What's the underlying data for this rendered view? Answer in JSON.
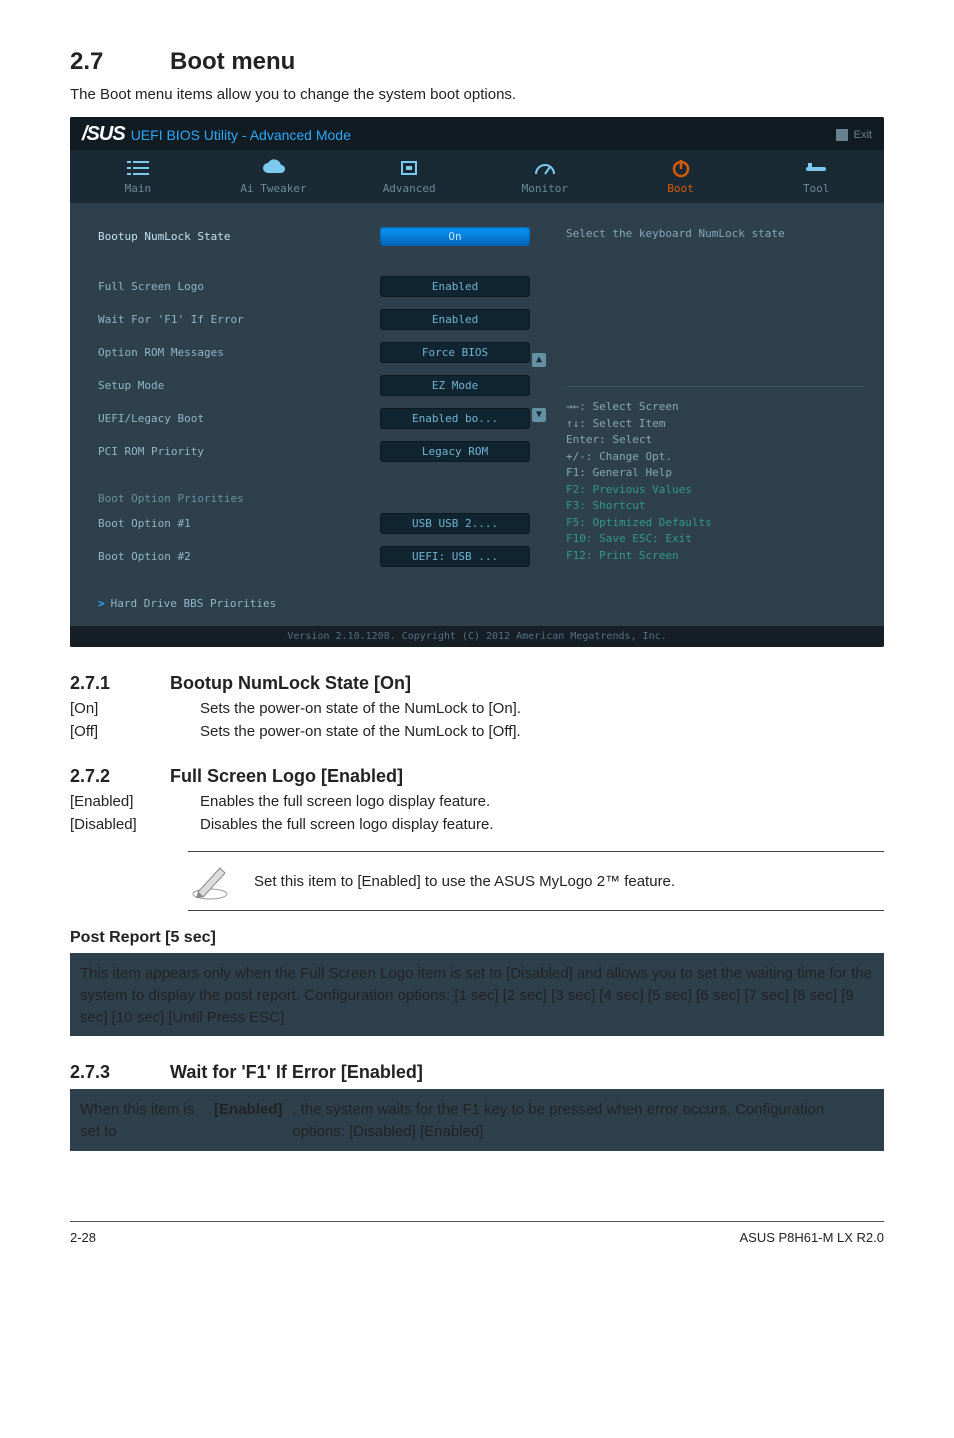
{
  "heading": {
    "num": "2.7",
    "title": "Boot menu"
  },
  "lead": "The Boot menu items allow you to change the system boot options.",
  "bios": {
    "brand": "/SUS",
    "title": "UEFI BIOS Utility - Advanced Mode",
    "exit": "Exit",
    "tabs": [
      {
        "label": "Main"
      },
      {
        "label": "Ai Tweaker"
      },
      {
        "label": "Advanced"
      },
      {
        "label": "Monitor"
      },
      {
        "label": "Boot"
      },
      {
        "label": "Tool"
      }
    ],
    "rows": [
      {
        "label": "Bootup NumLock State",
        "value": "On",
        "hl": true
      },
      {
        "label": "Full Screen Logo",
        "value": "Enabled"
      },
      {
        "label": "Wait For 'F1' If Error",
        "value": "Enabled"
      },
      {
        "label": "Option ROM Messages",
        "value": "Force BIOS"
      },
      {
        "label": "Setup Mode",
        "value": "EZ Mode"
      },
      {
        "label": "UEFI/Legacy Boot",
        "value": "Enabled bo..."
      },
      {
        "label": "PCI ROM Priority",
        "value": "Legacy ROM"
      }
    ],
    "prio_title": "Boot Option Priorities",
    "prio": [
      {
        "label": "Boot Option #1",
        "value": "USB USB 2...."
      },
      {
        "label": "Boot Option #2",
        "value": "UEFI: USB ..."
      }
    ],
    "sublink": "Hard Drive BBS Priorities",
    "help": "Select the keyboard NumLock state",
    "hints": [
      "→←: Select Screen",
      "↑↓: Select Item",
      "Enter: Select",
      "+/-: Change Opt.",
      "F1: General Help",
      "F2: Previous Values",
      "F3: Shortcut",
      "F5: Optimized Defaults",
      "F10: Save  ESC: Exit",
      "F12: Print Screen"
    ],
    "version": "Version 2.10.1208. Copyright (C) 2012 American Megatrends, Inc."
  },
  "sec271": {
    "num": "2.7.1",
    "title": "Bootup NumLock State [On]",
    "items": [
      {
        "k": "[On]",
        "v": "Sets the power-on state of the NumLock to [On]."
      },
      {
        "k": "[Off]",
        "v": "Sets the power-on state of the NumLock to [Off]."
      }
    ]
  },
  "sec272": {
    "num": "2.7.2",
    "title": "Full Screen Logo [Enabled]",
    "items": [
      {
        "k": "[Enabled]",
        "v": "Enables the full screen logo display feature."
      },
      {
        "k": "[Disabled]",
        "v": "Disables the full screen logo display feature."
      }
    ]
  },
  "note": "Set this item to [Enabled] to use the ASUS MyLogo 2™ feature.",
  "post": {
    "title": "Post Report [5 sec]",
    "text": "This item appears only when the Full Screen Logo item is set to [Disabled] and allows you to set the waiting time for the system to display the post report. Configuration options: [1 sec] [2 sec] [3 sec] [4 sec] [5 sec] [6 sec] [7 sec] [8 sec] [9 sec] [10 sec] [Until Press ESC]"
  },
  "sec273": {
    "num": "2.7.3",
    "title": "Wait for 'F1' If Error [Enabled]",
    "text_pre": "When this item is set to ",
    "text_bold": "[Enabled]",
    "text_post": ", the system waits for the F1 key to be pressed when error occurs. Configuration options: [Disabled] [Enabled]"
  },
  "footer": {
    "left": "2-28",
    "right": "ASUS P8H61-M LX R2.0"
  }
}
